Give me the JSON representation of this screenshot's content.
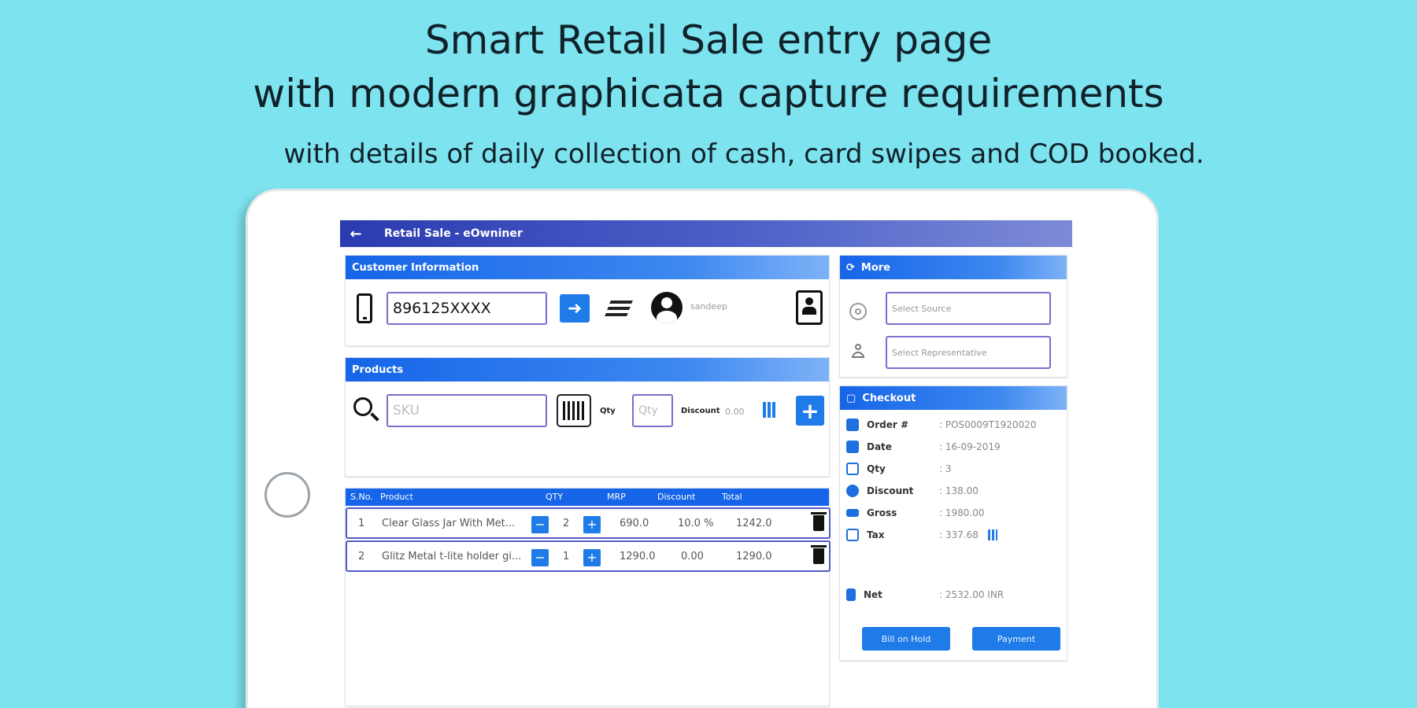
{
  "headline": {
    "line1": "Smart Retail Sale entry page",
    "line2": "with modern graphicata capture requirements",
    "line3": "with details of daily collection of cash, card swipes and COD booked."
  },
  "appbar": {
    "back": "←",
    "title": "Retail Sale - eOwniner"
  },
  "customer": {
    "header": "Customer Information",
    "phone_value": "896125XXXX",
    "customer_name": "sandeep"
  },
  "products": {
    "header": "Products",
    "sku_placeholder": "SKU",
    "qty_label": "Qty",
    "qty_placeholder": "Qty",
    "discount_label": "Discount",
    "discount_value": "0.00"
  },
  "table": {
    "columns": [
      "S.No.",
      "Product",
      "QTY",
      "MRP",
      "Discount",
      "Total"
    ],
    "rows": [
      {
        "sno": "1",
        "product": "Clear Glass Jar With Met...",
        "qty": "2",
        "mrp": "690.0",
        "discount": "10.0 %",
        "total": "1242.0"
      },
      {
        "sno": "2",
        "product": "Glitz Metal t-lite holder gi...",
        "qty": "1",
        "mrp": "1290.0",
        "discount": "0.00",
        "total": "1290.0"
      }
    ]
  },
  "more": {
    "header": "More",
    "source_placeholder": "Select Source",
    "rep_placeholder": "Select Representative"
  },
  "checkout": {
    "header": "Checkout",
    "rows": [
      {
        "label": "Order #",
        "value": ": POS0009T1920020"
      },
      {
        "label": "Date",
        "value": ": 16-09-2019"
      },
      {
        "label": "Qty",
        "value": ": 3"
      },
      {
        "label": "Discount",
        "value": ": 138.00"
      },
      {
        "label": "Gross",
        "value": ": 1980.00"
      },
      {
        "label": "Tax",
        "value": ": 337.68"
      }
    ],
    "net_label": "Net",
    "net_value": ": 2532.00 INR",
    "hold_button": "Bill on Hold",
    "payment_button": "Payment"
  },
  "colors": {
    "background": "#7de3ef",
    "accent": "#1e7be8",
    "appbar": "#2b3bb0"
  }
}
